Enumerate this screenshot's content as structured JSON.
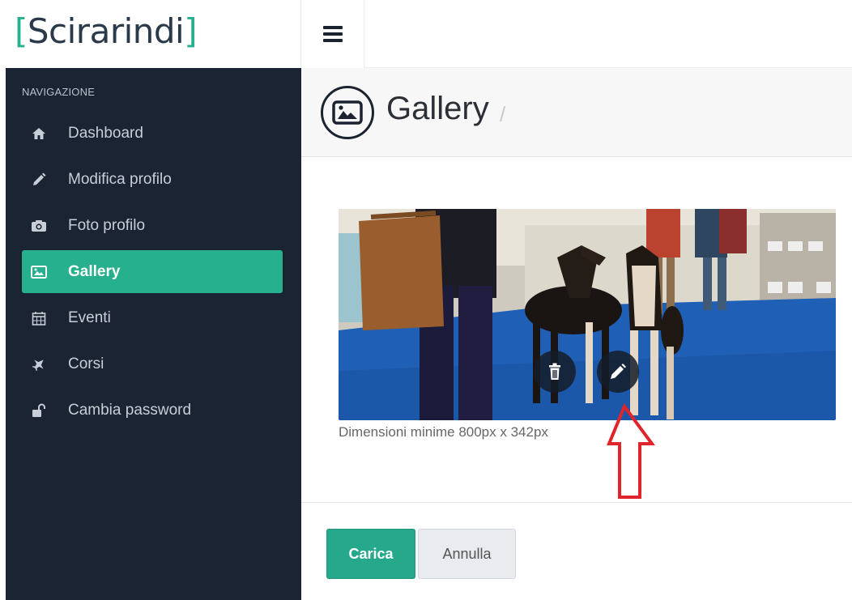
{
  "brand": {
    "open_bracket": "[",
    "name": "Scirarindi",
    "close_bracket": "]"
  },
  "colors": {
    "accent": "#26b08e",
    "sidebar_bg": "#1b2433",
    "annotation": "#e0242b"
  },
  "sidebar": {
    "heading": "NAVIGAZIONE",
    "items": [
      {
        "label": "Dashboard",
        "icon": "home-icon"
      },
      {
        "label": "Modifica profilo",
        "icon": "pencil-icon"
      },
      {
        "label": "Foto profilo",
        "icon": "camera-icon"
      },
      {
        "label": "Gallery",
        "icon": "picture-icon",
        "active": true
      },
      {
        "label": "Eventi",
        "icon": "calendar-icon"
      },
      {
        "label": "Corsi",
        "icon": "plane-icon"
      },
      {
        "label": "Cambia password",
        "icon": "unlock-icon"
      }
    ]
  },
  "page": {
    "title": "Gallery",
    "title_separator": "/"
  },
  "gallery": {
    "caption": "Dimensioni minime 800px x 342px",
    "actions": [
      {
        "name": "delete",
        "icon": "trash-icon"
      },
      {
        "name": "edit",
        "icon": "pencil-icon"
      }
    ]
  },
  "form": {
    "submit_label": "Carica",
    "cancel_label": "Annulla"
  }
}
